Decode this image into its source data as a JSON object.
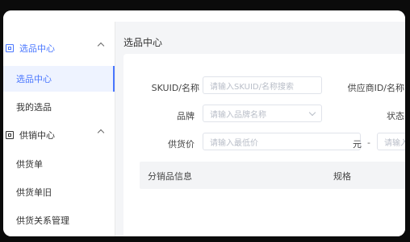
{
  "sidebar": {
    "groups": [
      {
        "label": "选品中心",
        "icon": "box-icon",
        "active": true
      },
      {
        "label": "供销中心",
        "icon": "box-icon",
        "active": false
      }
    ],
    "items": [
      {
        "label": "选品中心",
        "active": true
      },
      {
        "label": "我的选品",
        "active": false
      },
      {
        "label": "供货单",
        "active": false
      },
      {
        "label": "供货单旧",
        "active": false
      },
      {
        "label": "供货关系管理",
        "active": false
      }
    ]
  },
  "main": {
    "title": "选品中心",
    "filters": {
      "skuid_label": "SKUID/名称",
      "skuid_placeholder": "请输入SKUID/名称搜索",
      "supplier_label": "供应商ID/名称",
      "brand_label": "品牌",
      "brand_placeholder": "请输入品牌名称",
      "status_label": "状态",
      "price_label": "供货价",
      "price_min_placeholder": "请输入最低价",
      "price_unit": "元",
      "price_dash": "-",
      "price_max_placeholder": "请输入最"
    },
    "table": {
      "columns": [
        "分销品信息",
        "规格"
      ]
    }
  },
  "colors": {
    "accent": "#4a77ff",
    "sidebar_active_bg": "#eef3ff"
  }
}
